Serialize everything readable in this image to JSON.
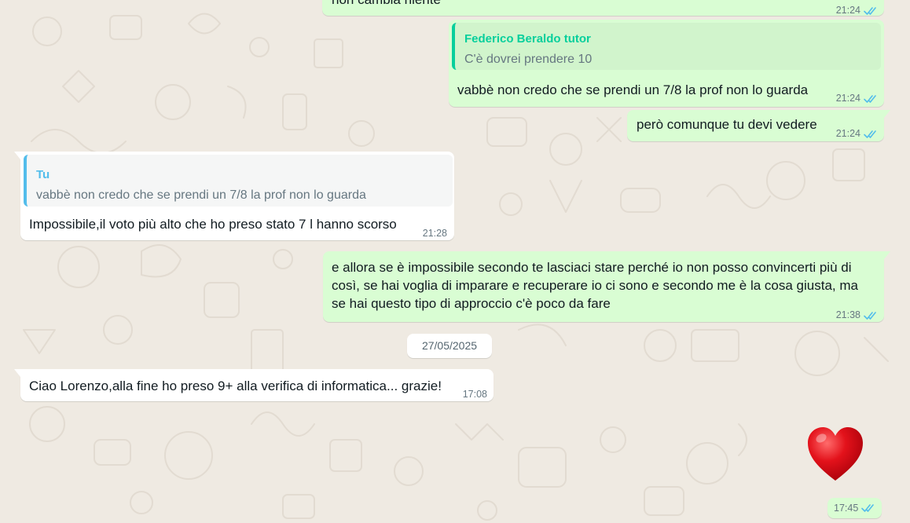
{
  "messages": [
    {
      "direction": "outgoing",
      "text": "non cambia niente",
      "time": "21:24",
      "status": "read"
    },
    {
      "direction": "outgoing",
      "quote": {
        "author": "Federico Beraldo tutor",
        "text": "C'è dovrei prendere 10"
      },
      "text": "vabbè non credo che se prendi un 7/8 la prof non lo guarda",
      "time": "21:24",
      "status": "read"
    },
    {
      "direction": "outgoing",
      "text": "però comunque tu devi vedere",
      "time": "21:24",
      "status": "read"
    },
    {
      "direction": "incoming",
      "quote": {
        "author": "Tu",
        "text": "vabbè non credo che se prendi un 7/8 la prof non lo guarda"
      },
      "text": "Impossibile,il voto più alto che ho preso stato 7 l hanno scorso",
      "time": "21:28"
    },
    {
      "direction": "outgoing",
      "text": "e allora se è impossibile secondo te lasciaci stare perché io non posso convincerti più di così, se hai voglia di imparare e recuperare io ci sono e secondo me è la cosa giusta, ma se hai questo tipo di approccio c'è poco da fare",
      "time": "21:38",
      "status": "read"
    },
    {
      "direction": "incoming",
      "text": "Ciao Lorenzo,alla fine ho preso 9+ alla verifica di informatica... grazie!",
      "time": "17:08"
    },
    {
      "direction": "outgoing",
      "emoji": "heart-emoji",
      "time": "17:45",
      "status": "read"
    }
  ],
  "date_separator": "27/05/2025",
  "colors": {
    "background": "#efeae2",
    "outgoing_bubble": "#d9fdd3",
    "incoming_bubble": "#ffffff",
    "read_tick": "#53bdeb",
    "quote_outgoing_accent": "#06cf9c",
    "quote_incoming_accent": "#53bdeb",
    "heart": "#e3121b"
  }
}
